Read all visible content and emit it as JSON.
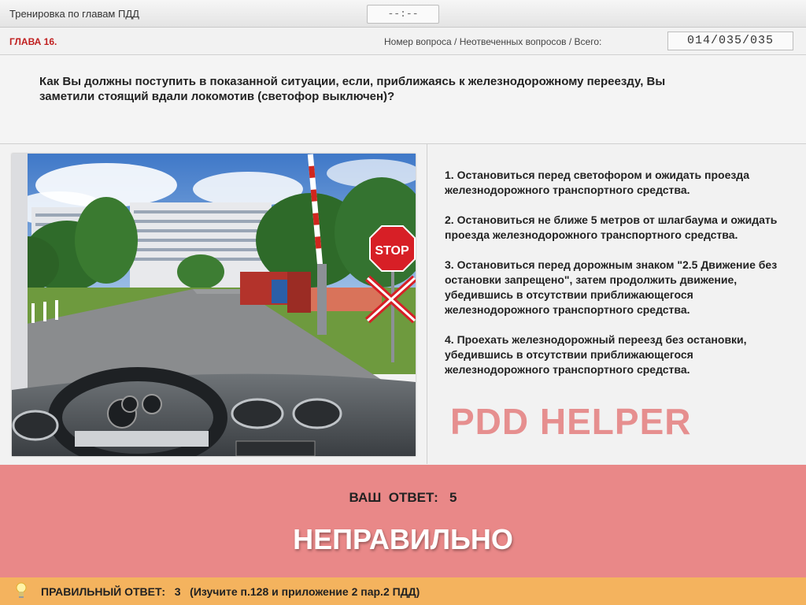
{
  "window": {
    "title": "Тренировка по главам ПДД",
    "timer": "--:--"
  },
  "chapter": {
    "label": "ГЛАВА 16.",
    "counter_label": "Номер вопроса / Неотвеченных вопросов / Всего:",
    "counter_value": "014/035/035"
  },
  "question": {
    "text": "Как Вы должны поступить в показанной ситуации, если, приближаясь к железнодорожному переезду, Вы заметили стоящий вдали локомотив (светофор выключен)?"
  },
  "answers": [
    "1.  Остановиться перед светофором и ожидать проезда железнодорожного транспортного средства.",
    "2.  Остановиться не ближе 5 метров от шлагбаума и ожидать проезда железнодорожного транспортного средства.",
    "3.  Остановиться перед дорожным знаком \"2.5 Движение без остановки запрещено\", затем продолжить движение, убедившись в отсутствии приближающегося железнодорожного транспортного средства.",
    "4.  Проехать железнодорожный переезд без остановки, убедившись в отсутствии приближающегося железнодорожного транспортного средства."
  ],
  "image": {
    "sign_text": "STOP"
  },
  "watermark": "PDD HELPER",
  "result": {
    "your_answer_label": "ВАШ  ОТВЕТ:   5",
    "verdict": "НЕПРАВИЛЬНО",
    "background": "#e98888"
  },
  "correct": {
    "text": "ПРАВИЛЬНЫЙ ОТВЕТ:   3   (Изучите п.128 и приложение 2 пар.2 ПДД)",
    "background": "#f4b35e",
    "icon": "lightbulb-icon"
  }
}
